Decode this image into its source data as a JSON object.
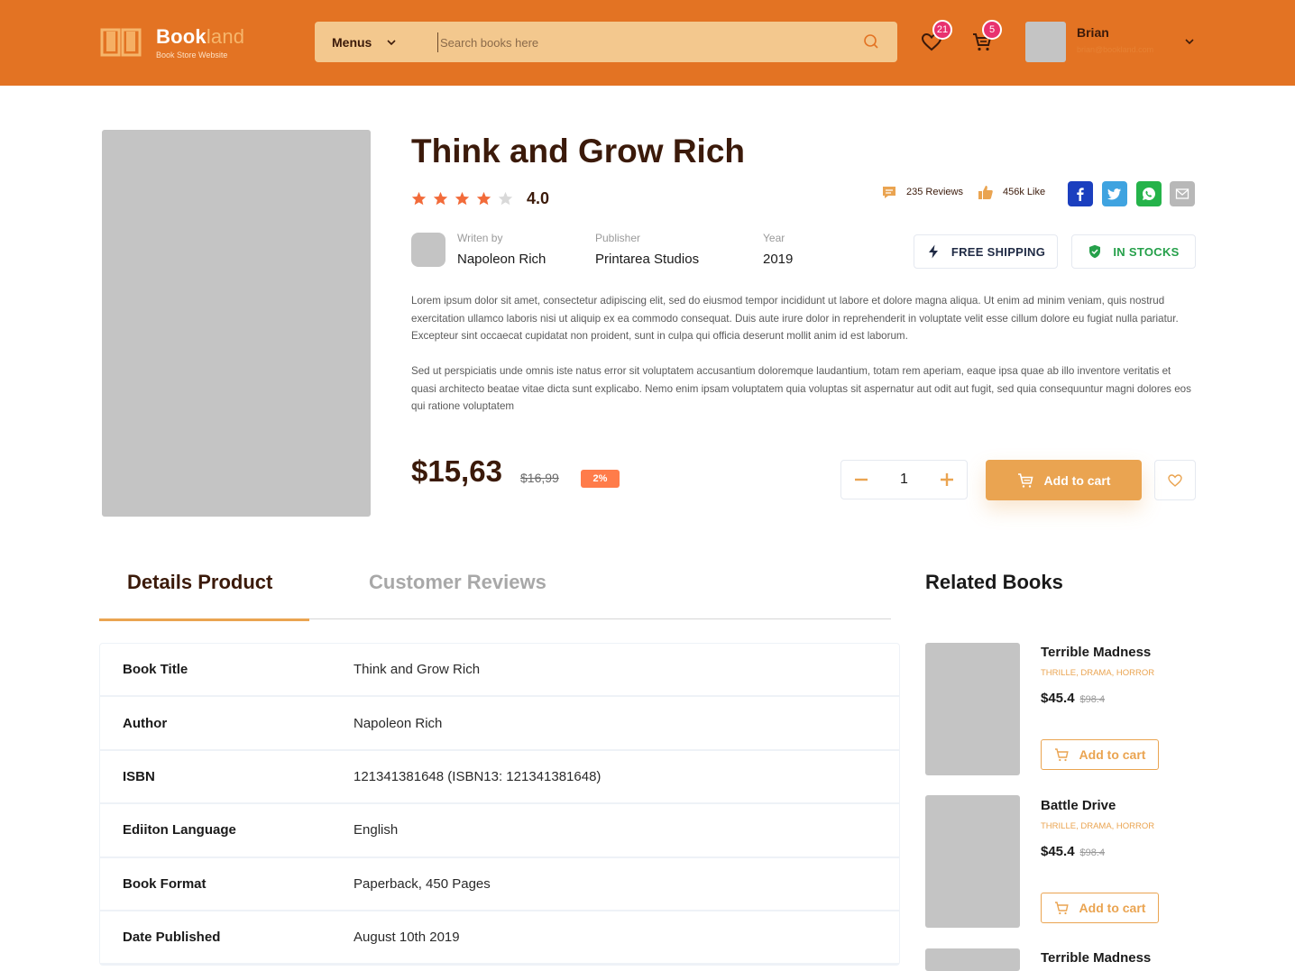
{
  "header": {
    "logo_name_bold": "Book",
    "logo_name_light": "land",
    "logo_sub": "Book Store Website",
    "menus_label": "Menus",
    "search_placeholder": "Search books here",
    "wishlist_count": "21",
    "cart_count": "5",
    "user_name": "Brian",
    "user_email": "brian@bookland.com"
  },
  "product": {
    "title": "Think and Grow Rich",
    "rating": "4.0",
    "rating_value": 4,
    "rating_max": 5,
    "reviews": "235 Reviews",
    "likes": "456k Like",
    "written_by_label": "Writen by",
    "author": "Napoleon Rich",
    "publisher_label": "Publisher",
    "publisher": "Printarea Studios",
    "year_label": "Year",
    "year": "2019",
    "free_shipping": "FREE SHIPPING",
    "in_stocks": "IN STOCKS",
    "desc1": "Lorem ipsum dolor sit amet, consectetur adipiscing elit, sed do eiusmod tempor incididunt ut labore et dolore magna aliqua. Ut enim ad minim veniam, quis nostrud exercitation ullamco laboris nisi ut aliquip ex ea commodo consequat. Duis aute irure dolor in reprehenderit in voluptate velit esse cillum dolore eu fugiat nulla pariatur. Excepteur sint occaecat cupidatat non proident, sunt in culpa qui officia deserunt mollit anim id est laborum.",
    "desc2": "Sed ut perspiciatis unde omnis iste natus error sit voluptatem accusantium doloremque laudantium, totam rem aperiam, eaque ipsa quae ab illo inventore veritatis et quasi architecto beatae vitae dicta sunt explicabo. Nemo enim ipsam voluptatem quia voluptas sit aspernatur aut odit aut fugit, sed quia consequuntur magni dolores eos qui ratione voluptatem",
    "price": "$15,63",
    "old_price": "$16,99",
    "discount": "2%",
    "quantity": "1",
    "add_to_cart": "Add to cart"
  },
  "tabs": {
    "details": "Details Product",
    "reviews": "Customer Reviews"
  },
  "details": [
    {
      "key": "Book Title",
      "value": "Think and Grow Rich"
    },
    {
      "key": "Author",
      "value": "Napoleon Rich"
    },
    {
      "key": "ISBN",
      "value": "121341381648 (ISBN13: 121341381648)"
    },
    {
      "key": "Ediiton Language",
      "value": "English"
    },
    {
      "key": "Book Format",
      "value": "Paperback, 450 Pages"
    },
    {
      "key": "Date Published",
      "value": "August 10th 2019"
    }
  ],
  "related": {
    "title": "Related Books",
    "items": [
      {
        "name": "Terrible Madness",
        "genre": "THRILLE, DRAMA, HORROR",
        "price": "$45.4",
        "old_price": "$98.4",
        "cart": "Add to cart"
      },
      {
        "name": "Battle Drive",
        "genre": "THRILLE, DRAMA, HORROR",
        "price": "$45.4",
        "old_price": "$98.4",
        "cart": "Add to cart"
      },
      {
        "name": "Terrible Madness"
      }
    ]
  },
  "colors": {
    "header": "#e37323",
    "accent": "#eaa451",
    "title": "#3b1a0a",
    "badge": "#e8326f",
    "facebook": "#1b3fbf",
    "twitter": "#3fa3e0",
    "whatsapp": "#25b34a",
    "email": "#b8b8b8"
  }
}
